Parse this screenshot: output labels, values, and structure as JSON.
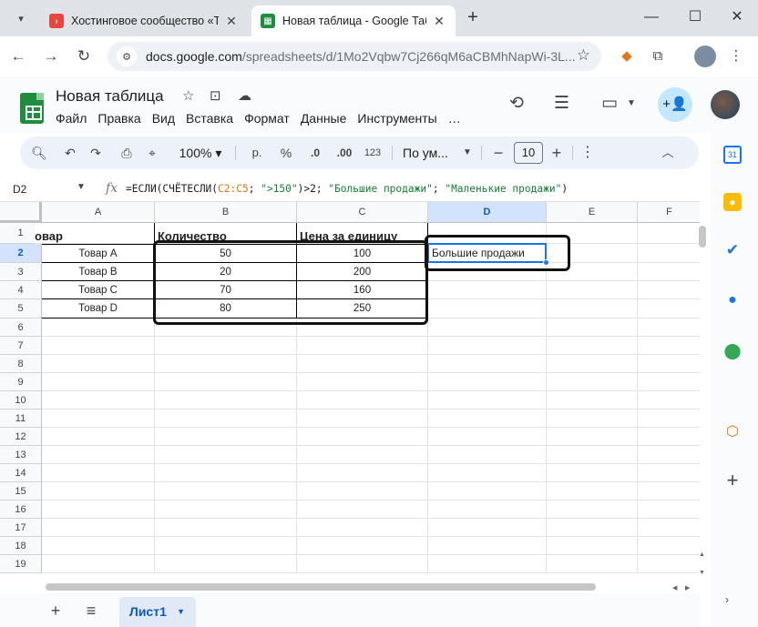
{
  "browser": {
    "tabs": [
      {
        "title": "Хостинговое сообщество «Tim",
        "favicon": "timeweb-icon"
      },
      {
        "title": "Новая таблица - Google Табли",
        "favicon": "sheets-icon"
      }
    ],
    "url_host": "docs.google.com",
    "url_path": "/spreadsheets/d/1Mo2Vqbw7Cj266qM6aCBMhNapWi-3L..."
  },
  "doc": {
    "title": "Новая таблица",
    "menu": [
      "Файл",
      "Правка",
      "Вид",
      "Вставка",
      "Формат",
      "Данные",
      "Инструменты",
      "…"
    ]
  },
  "toolbar": {
    "zoom": "100%",
    "currency": "р.",
    "percent": "%",
    "dec_decrease": ".0",
    "dec_increase": ".00",
    "number_format": "123",
    "font": "По ум...",
    "font_size": "10"
  },
  "formula_bar": {
    "name_box": "D2",
    "fx": "fx",
    "parts": [
      {
        "t": "=ЕСЛИ(СЧЁТЕСЛИ(",
        "k": "plain"
      },
      {
        "t": "C2:C5",
        "k": "ref"
      },
      {
        "t": "; ",
        "k": "plain"
      },
      {
        "t": "\">150\"",
        "k": "str"
      },
      {
        "t": ")>2; ",
        "k": "plain"
      },
      {
        "t": "\"Большие продажи\"",
        "k": "str"
      },
      {
        "t": "; ",
        "k": "plain"
      },
      {
        "t": "\"Маленькие продажи\"",
        "k": "str"
      },
      {
        "t": ")",
        "k": "plain"
      }
    ]
  },
  "sheet": {
    "columns": [
      "A",
      "B",
      "C",
      "D",
      "E",
      "F"
    ],
    "rows": [
      "1",
      "2",
      "3",
      "4",
      "5",
      "6",
      "7",
      "8",
      "9",
      "10",
      "11",
      "12",
      "13",
      "14",
      "15",
      "16",
      "17",
      "18",
      "19"
    ],
    "selected_col": "D",
    "selected_row": "2",
    "headers": [
      "Товар",
      "Количество",
      "Цена за единицу"
    ],
    "header_a_visible": "овар",
    "data": [
      [
        "Товар A",
        "50",
        "100"
      ],
      [
        "Товар B",
        "20",
        "200"
      ],
      [
        "Товар C",
        "70",
        "160"
      ],
      [
        "Товар D",
        "80",
        "250"
      ]
    ],
    "d2": "Большие продажи"
  },
  "sheet_tabs": {
    "active": "Лист1"
  }
}
